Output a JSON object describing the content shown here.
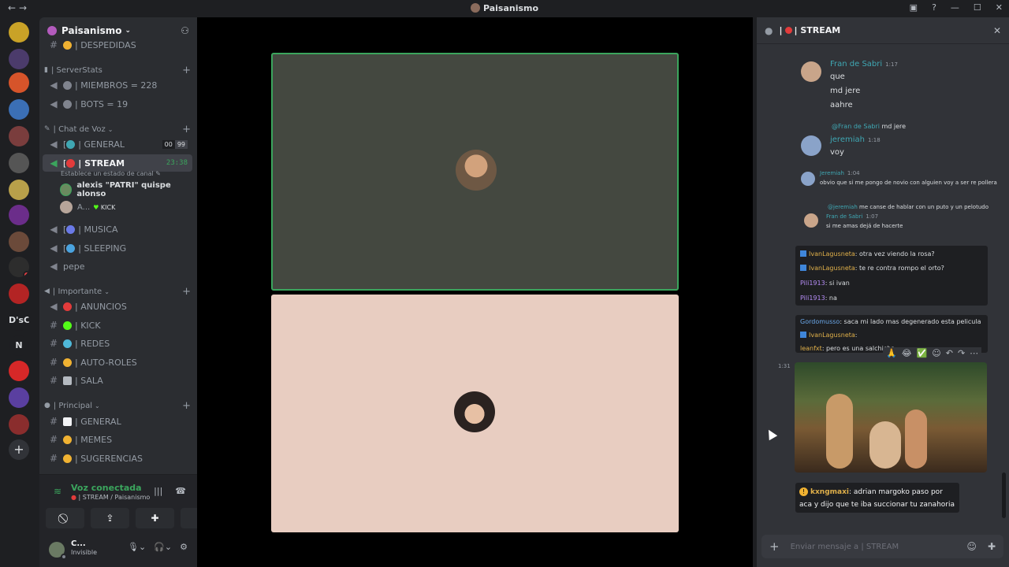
{
  "window": {
    "title": "Paisanismo",
    "controls": [
      "inbox-icon",
      "help-icon",
      "minimize-icon",
      "maximize-icon",
      "close-icon"
    ]
  },
  "guild": {
    "name": "Paisanismo",
    "letters": [
      "D'sC",
      "N"
    ]
  },
  "channels": {
    "despedidas": "| DESPEDIDAS",
    "cat_serverstats": "| ServerStats",
    "miembros": "| MIEMBROS = 228",
    "bots": "| BOTS = 19",
    "cat_voz": "| Chat de Voz",
    "general_voice": "| GENERAL",
    "general_voice_count_a": "00",
    "general_voice_count_b": "99",
    "stream": "| STREAM",
    "stream_prefix": "[",
    "stream_timer": "23:38",
    "stream_status": "Establece un estado de canal",
    "vc_user1": "alexis \"PATRI\" quispe alonso",
    "vc_user2": "A...",
    "vc_user2_badge": "KICK",
    "musica": "| MUSICA",
    "sleeping": "| SLEEPING",
    "pepe": "pepe",
    "cat_importante": "| Importante",
    "anuncios": "| ANUNCIOS",
    "kick": "| KICK",
    "redes": "| REDES",
    "autoroles": "| AUTO-ROLES",
    "sala": "| SALA",
    "cat_principal": "| Principal",
    "general_text": "| GENERAL",
    "memes": "| MEMES",
    "sugerencias": "| SUGERENCIAS"
  },
  "voice": {
    "state": "Voz conectada",
    "location": "| STREAM / Paisanismo"
  },
  "user": {
    "name": "C...",
    "status": "Invisible"
  },
  "chat": {
    "header": "| STREAM",
    "messages": [
      {
        "name": "Fran de Sabri",
        "time": "1:17",
        "lines": [
          "que",
          "md jere",
          "aahre"
        ]
      },
      {
        "reply_to": "@Fran de Sabri",
        "reply_text": "md jere",
        "name": "jeremiah",
        "time": "1:18",
        "lines": [
          "voy"
        ]
      },
      {
        "name": "Jeremiah",
        "time": "1:04",
        "lines": [
          "obvio que si me pongo de novio con alguien voy a ser re pollera"
        ]
      },
      {
        "reply_to": "@jeremiah",
        "reply_text": "me canse de hablar con un puto y un pelotudo",
        "name": "Fran de Sabri",
        "time": "1:07",
        "lines": [
          "si me amas dejá de hacerte"
        ]
      }
    ],
    "embed1": [
      {
        "user": "IvanLagusneta",
        "text": ": otra vez viendo la rosa?"
      },
      {
        "user": "IvanLagusneta",
        "text": ": te re contra rompo el orto?"
      },
      {
        "user": "Pili1913",
        "text": ": si ivan"
      },
      {
        "user": "Pili1913",
        "text": ": na"
      }
    ],
    "embed2": [
      {
        "user": "Gordomusso",
        "text": ": saca mi lado mas degenerado esta pelicula"
      },
      {
        "user": "IvanLagusneta",
        "text": ":"
      },
      {
        "user": "leanfxt",
        "text": ": pero es una salchicha"
      }
    ],
    "gif_time": "1:31",
    "last_user": "kxngmaxi",
    "last_text": ": adrian margoko paso por aca y dijo que te iba succionar tu zanahoria",
    "composer_placeholder": "Enviar mensaje a | STREAM"
  },
  "colors": {
    "accent_green": "#3ba55d",
    "link_teal": "#3fa7b3",
    "bg": "#1e1f22"
  }
}
